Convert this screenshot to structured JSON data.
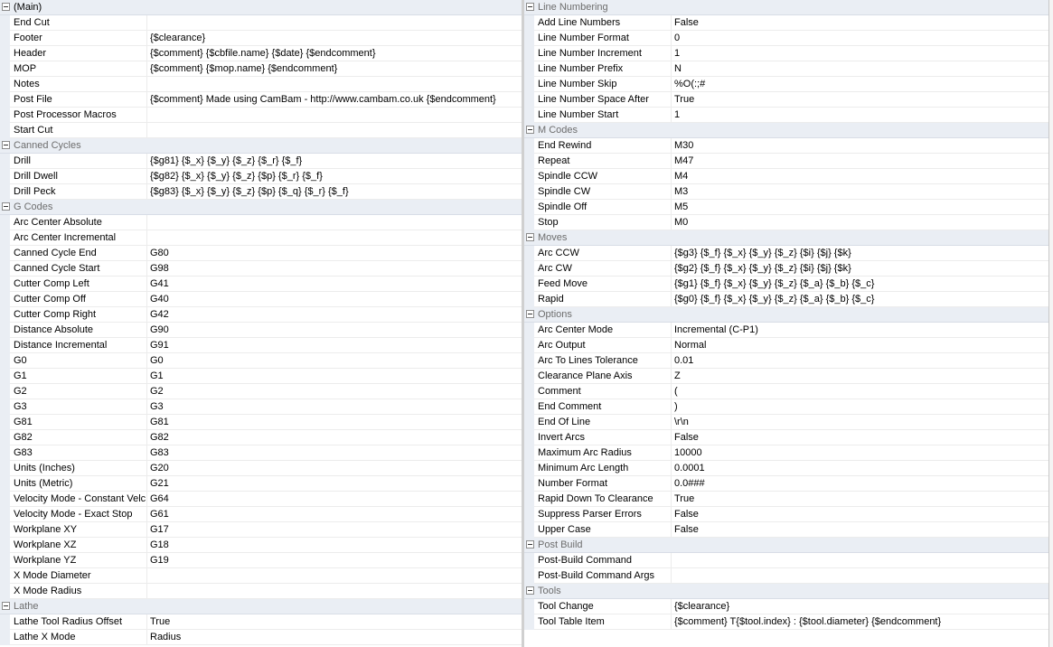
{
  "left": [
    {
      "category": "(Main)",
      "main": true,
      "rows": [
        {
          "name": "End Cut",
          "value": ""
        },
        {
          "name": "Footer",
          "value": "{$clearance}"
        },
        {
          "name": "Header",
          "value": "{$comment} {$cbfile.name} {$date} {$endcomment}"
        },
        {
          "name": "MOP",
          "value": "{$comment} {$mop.name} {$endcomment}"
        },
        {
          "name": "Notes",
          "value": ""
        },
        {
          "name": "Post File",
          "value": "{$comment} Made using CamBam - http://www.cambam.co.uk {$endcomment}"
        },
        {
          "name": "Post Processor Macros",
          "value": ""
        },
        {
          "name": "Start Cut",
          "value": ""
        }
      ]
    },
    {
      "category": "Canned Cycles",
      "rows": [
        {
          "name": "Drill",
          "value": "{$g81} {$_x} {$_y} {$_z} {$_r} {$_f}"
        },
        {
          "name": "Drill Dwell",
          "value": "{$g82} {$_x} {$_y} {$_z} {$p} {$_r} {$_f}"
        },
        {
          "name": "Drill Peck",
          "value": "{$g83} {$_x} {$_y} {$_z} {$p} {$_q} {$_r} {$_f}"
        }
      ]
    },
    {
      "category": "G Codes",
      "rows": [
        {
          "name": "Arc Center Absolute",
          "value": ""
        },
        {
          "name": "Arc Center Incremental",
          "value": ""
        },
        {
          "name": "Canned Cycle End",
          "value": "G80"
        },
        {
          "name": "Canned Cycle Start",
          "value": "G98"
        },
        {
          "name": "Cutter Comp Left",
          "value": "G41"
        },
        {
          "name": "Cutter Comp Off",
          "value": "G40"
        },
        {
          "name": "Cutter Comp Right",
          "value": "G42"
        },
        {
          "name": "Distance Absolute",
          "value": "G90"
        },
        {
          "name": "Distance Incremental",
          "value": "G91"
        },
        {
          "name": "G0",
          "value": "G0"
        },
        {
          "name": "G1",
          "value": "G1"
        },
        {
          "name": "G2",
          "value": "G2"
        },
        {
          "name": "G3",
          "value": "G3"
        },
        {
          "name": "G81",
          "value": "G81"
        },
        {
          "name": "G82",
          "value": "G82"
        },
        {
          "name": "G83",
          "value": "G83"
        },
        {
          "name": "Units (Inches)",
          "value": "G20"
        },
        {
          "name": "Units (Metric)",
          "value": "G21"
        },
        {
          "name": "Velocity Mode - Constant Velc",
          "value": "G64"
        },
        {
          "name": "Velocity Mode - Exact Stop",
          "value": "G61"
        },
        {
          "name": "Workplane XY",
          "value": "G17"
        },
        {
          "name": "Workplane XZ",
          "value": "G18"
        },
        {
          "name": "Workplane YZ",
          "value": "G19"
        },
        {
          "name": "X Mode Diameter",
          "value": ""
        },
        {
          "name": "X Mode Radius",
          "value": ""
        }
      ]
    },
    {
      "category": "Lathe",
      "rows": [
        {
          "name": "Lathe Tool Radius Offset",
          "value": "True"
        },
        {
          "name": "Lathe X Mode",
          "value": "Radius"
        }
      ]
    }
  ],
  "right": [
    {
      "category": "Line Numbering",
      "rows": [
        {
          "name": "Add Line Numbers",
          "value": "False"
        },
        {
          "name": "Line Number Format",
          "value": "0"
        },
        {
          "name": "Line Number Increment",
          "value": "1"
        },
        {
          "name": "Line Number Prefix",
          "value": "N"
        },
        {
          "name": "Line Number Skip",
          "value": "%O(:;#"
        },
        {
          "name": "Line Number Space After",
          "value": "True"
        },
        {
          "name": "Line Number Start",
          "value": "1"
        }
      ]
    },
    {
      "category": "M Codes",
      "rows": [
        {
          "name": "End Rewind",
          "value": "M30"
        },
        {
          "name": "Repeat",
          "value": "M47"
        },
        {
          "name": "Spindle CCW",
          "value": "M4"
        },
        {
          "name": "Spindle CW",
          "value": "M3"
        },
        {
          "name": "Spindle Off",
          "value": "M5"
        },
        {
          "name": "Stop",
          "value": "M0"
        }
      ]
    },
    {
      "category": "Moves",
      "rows": [
        {
          "name": "Arc CCW",
          "value": "{$g3} {$_f} {$_x} {$_y} {$_z} {$i} {$j} {$k}"
        },
        {
          "name": "Arc CW",
          "value": "{$g2} {$_f} {$_x} {$_y} {$_z} {$i} {$j} {$k}"
        },
        {
          "name": "Feed Move",
          "value": "{$g1} {$_f} {$_x} {$_y} {$_z} {$_a} {$_b} {$_c}"
        },
        {
          "name": "Rapid",
          "value": "{$g0} {$_f} {$_x} {$_y} {$_z} {$_a} {$_b} {$_c}"
        }
      ]
    },
    {
      "category": "Options",
      "rows": [
        {
          "name": "Arc Center Mode",
          "value": "Incremental (C-P1)"
        },
        {
          "name": "Arc Output",
          "value": "Normal"
        },
        {
          "name": "Arc To Lines Tolerance",
          "value": "0.01"
        },
        {
          "name": "Clearance Plane Axis",
          "value": "Z"
        },
        {
          "name": "Comment",
          "value": "("
        },
        {
          "name": "End Comment",
          "value": ")"
        },
        {
          "name": "End Of Line",
          "value": "\\r\\n"
        },
        {
          "name": "Invert Arcs",
          "value": "False"
        },
        {
          "name": "Maximum Arc Radius",
          "value": "10000"
        },
        {
          "name": "Minimum Arc Length",
          "value": "0.0001"
        },
        {
          "name": "Number Format",
          "value": "0.0###"
        },
        {
          "name": "Rapid Down To Clearance",
          "value": "True"
        },
        {
          "name": "Suppress Parser Errors",
          "value": "False"
        },
        {
          "name": "Upper Case",
          "value": "False"
        }
      ]
    },
    {
      "category": "Post Build",
      "rows": [
        {
          "name": "Post-Build Command",
          "value": ""
        },
        {
          "name": "Post-Build Command Args",
          "value": ""
        }
      ]
    },
    {
      "category": "Tools",
      "rows": [
        {
          "name": "Tool Change",
          "value": "{$clearance}"
        },
        {
          "name": "Tool Table Item",
          "value": "{$comment} T{$tool.index} : {$tool.diameter} {$endcomment}"
        }
      ]
    }
  ]
}
